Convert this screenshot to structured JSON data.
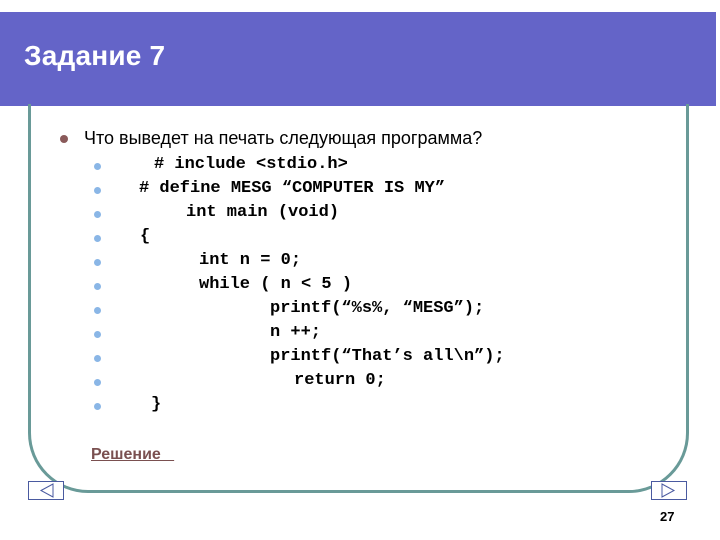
{
  "slide": {
    "title": "Задание 7",
    "question": "Что выведет на печать следующая программа?",
    "code_lines": [
      "# include <stdio.h>",
      "# define MESG “COMPUTER IS MY”",
      "int main (void)",
      "{",
      "int n = 0;",
      "while ( n < 5 )",
      "printf(“%s%, “MESG”);",
      "n ++;",
      "printf(“That’s all\\n”);",
      "return 0;",
      "}"
    ],
    "solution_link": "Решение   ",
    "page_number": "27"
  },
  "navigation": {
    "prev_icon": "triangle-left-icon",
    "next_icon": "triangle-right-icon"
  },
  "colors": {
    "header_bg": "#6464c8",
    "frame_border": "#699a98",
    "link": "#7a5050",
    "sub_bullet": "#8ab6e6",
    "main_bullet": "#8a5a5a"
  }
}
